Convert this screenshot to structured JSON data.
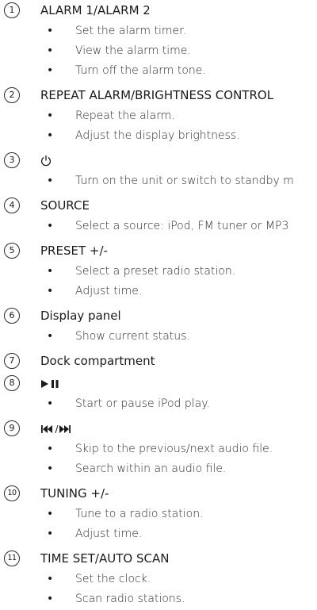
{
  "items": [
    {
      "num": "1",
      "title": "ALARM 1/ALARM 2",
      "bullets": [
        "Set the alarm timer.",
        "View the alarm time.",
        "Turn off the alarm tone."
      ]
    },
    {
      "num": "2",
      "title": "REPEAT ALARM/BRIGHTNESS CONTROL",
      "bullets": [
        "Repeat the alarm.",
        "Adjust the display brightness."
      ]
    },
    {
      "num": "3",
      "title_icon": "power-icon",
      "bullets": [
        "Turn on the unit or switch to standby m"
      ]
    },
    {
      "num": "4",
      "title": "SOURCE",
      "bullets": [
        "Select a source: iPod, FM tuner or MP3"
      ]
    },
    {
      "num": "5",
      "title": "PRESET +/-",
      "bullets": [
        "Select a preset radio station.",
        "Adjust time."
      ]
    },
    {
      "num": "6",
      "title": "Display panel",
      "bullets": [
        "Show current status."
      ]
    },
    {
      "num": "7",
      "title": "Dock compartment",
      "bullets": []
    },
    {
      "num": "8",
      "title_icon": "play-pause-icon",
      "bullets": [
        "Start or pause iPod play."
      ]
    },
    {
      "num": "9",
      "title_icon": "prev-next-icon",
      "bullets": [
        "Skip to the previous/next audio file.",
        "Search within an audio file."
      ]
    },
    {
      "num": "10",
      "title": "TUNING +/-",
      "bullets": [
        "Tune to a radio station.",
        "Adjust time."
      ]
    },
    {
      "num": "11",
      "title": "TIME SET/AUTO SCAN",
      "bullets": [
        "Set the clock.",
        "Scan radio stations."
      ]
    }
  ],
  "bullet_char": "•"
}
